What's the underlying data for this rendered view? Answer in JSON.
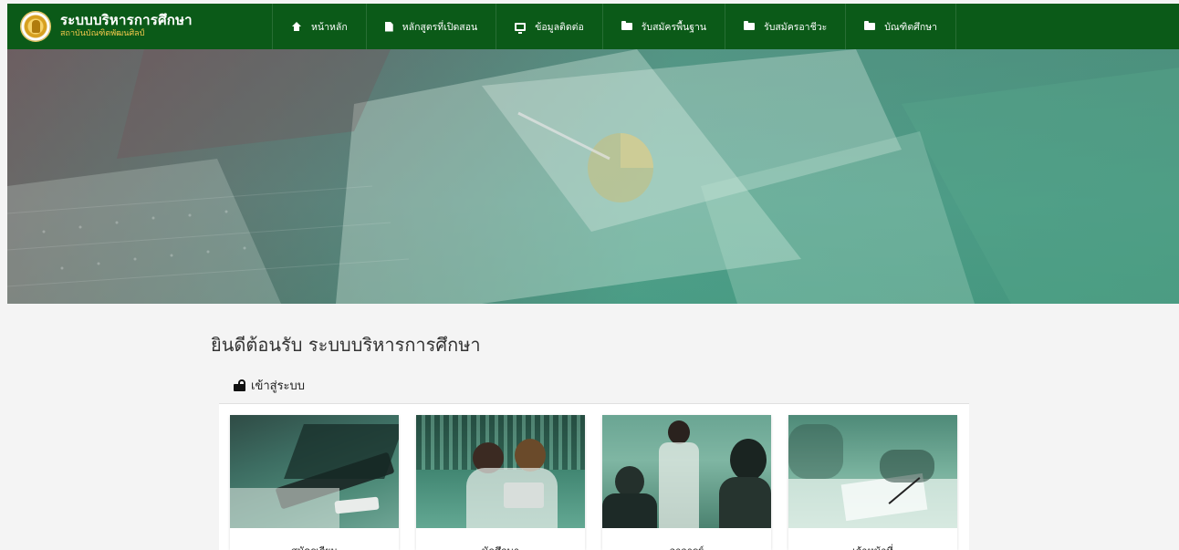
{
  "brand": {
    "title": "ระบบบริหารการศึกษา",
    "subtitle": "สถาบันบัณฑิตพัฒนศิลป์"
  },
  "nav": {
    "items": [
      {
        "label": "หน้าหลัก",
        "icon": "home-icon"
      },
      {
        "label": "หลักสูตรที่เปิดสอน",
        "icon": "file-icon"
      },
      {
        "label": "ข้อมูลติดต่อ",
        "icon": "monitor-icon"
      },
      {
        "label": "รับสมัครพื้นฐาน",
        "icon": "folder-icon"
      },
      {
        "label": "รับสมัครอาชีวะ",
        "icon": "folder-icon"
      },
      {
        "label": "บัณฑิตศึกษา",
        "icon": "folder-icon"
      }
    ]
  },
  "main": {
    "welcome": "ยินดีต้อนรับ ระบบบริหารการศึกษา",
    "login_heading": "เข้าสู่ระบบ",
    "cards": [
      {
        "label": "สมัครเรียน"
      },
      {
        "label": "นักศึกษา"
      },
      {
        "label": "อาจารย์"
      },
      {
        "label": "เจ้าหน้าที่"
      }
    ]
  },
  "colors": {
    "navbar": "#0b5a18",
    "brand_subtitle": "#f6c94d",
    "hero_tint": "#4fb495"
  }
}
